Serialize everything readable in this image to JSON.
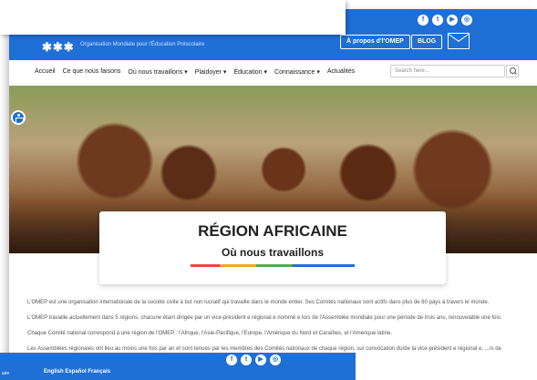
{
  "header": {
    "tagline": "Organisation Mondiale pour l'Éducation Préscolaire",
    "about_btn": "À propos d'l'OMEP",
    "blog_btn": "BLOG",
    "social_icons": [
      "facebook-icon",
      "twitter-icon",
      "youtube-icon",
      "instagram-icon"
    ]
  },
  "nav": {
    "items": [
      "Accueil",
      "Ce que nous faisons",
      "Où nous travaillons ▾",
      "Plaidoyer ▾",
      "Éducation ▾",
      "Connaissance ▾",
      "Actualités"
    ],
    "search_placeholder": "Search here..."
  },
  "hero": {
    "title": "RÉGION AFRICAINE",
    "subtitle": "Où nous travaillons"
  },
  "body": {
    "p1": "L'OMEP est une organisation internationale de la société civile à but non lucratif qui travaille dans le monde entier. Ses Comités nationaux sont actifs dans plus de 60 pays à travers le monde.",
    "p2": "L'OMEP travaille actuellement dans 5 régions, chacune étant dirigée par un vice-président e régional e nommé e lors de l'Assemblée mondiale pour une période de trois ans, renouvelable une fois.",
    "p3": "Chaque Comité national correspond à une région de l'OMEP : l'Afrique, l'Asie-Pacifique, l'Europe, l'Amérique du Nord et Caraïbes, et l'Amérique latine.",
    "p4": "Les Assemblées régionales ont lieu au moins une fois par an et sont tenues par les membres des Comités nationaux de chaque région, sur convocation du/de la vice-président e régional e, ...rs de l'Assemblée mondiale, et d'examiner aussi le travail des"
  },
  "bottom": {
    "languages": "English Español Français",
    "left_fragment": "aire"
  }
}
